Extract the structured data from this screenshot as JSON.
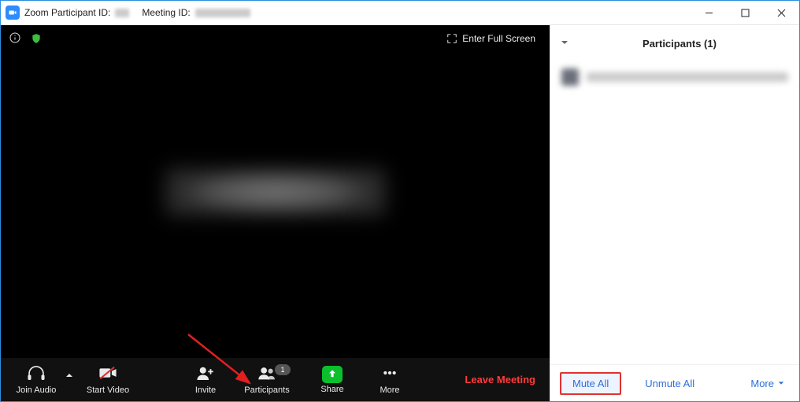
{
  "titlebar": {
    "app_prefix": "Zoom Participant ID:",
    "meeting_prefix": "Meeting ID:"
  },
  "video": {
    "full_screen_label": "Enter Full Screen"
  },
  "controls": {
    "join_audio": "Join Audio",
    "start_video": "Start Video",
    "invite": "Invite",
    "participants": "Participants",
    "participants_badge": "1",
    "share": "Share",
    "more": "More",
    "leave": "Leave Meeting"
  },
  "panel": {
    "title": "Participants (1)",
    "mute_all": "Mute All",
    "unmute_all": "Unmute All",
    "more": "More"
  }
}
